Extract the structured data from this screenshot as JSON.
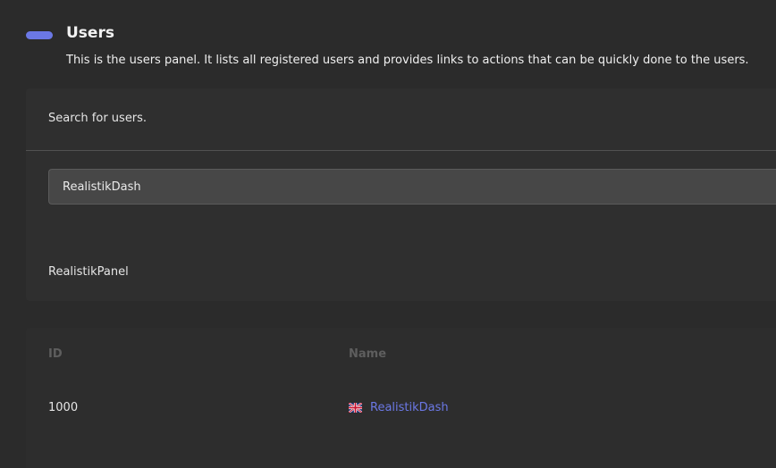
{
  "header": {
    "title": "Users",
    "description": "This is the users panel. It lists all registered users and provides links to actions that can be quickly done to the users."
  },
  "search": {
    "heading": "Search for users.",
    "input_value": "RealistikDash",
    "results": [
      "RealistikPanel"
    ]
  },
  "table": {
    "columns": [
      "ID",
      "Name"
    ],
    "rows": [
      {
        "id": "1000",
        "name": "RealistikDash",
        "flag_icon": "uk-flag-icon"
      }
    ]
  },
  "colors": {
    "accent": "#6b78e5",
    "background": "#2b2b2b"
  }
}
